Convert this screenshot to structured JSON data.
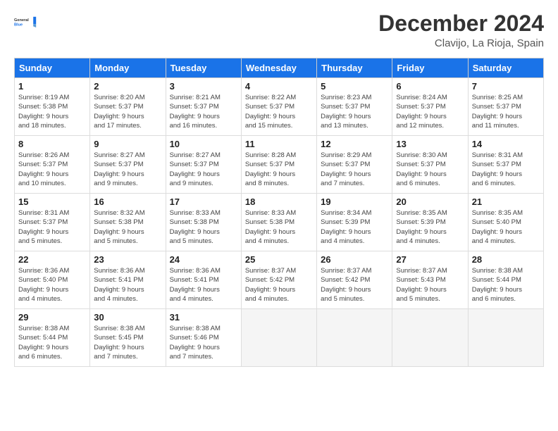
{
  "header": {
    "logo_line1": "General",
    "logo_line2": "Blue",
    "month": "December 2024",
    "location": "Clavijo, La Rioja, Spain"
  },
  "weekdays": [
    "Sunday",
    "Monday",
    "Tuesday",
    "Wednesday",
    "Thursday",
    "Friday",
    "Saturday"
  ],
  "weeks": [
    [
      {
        "day": 1,
        "info": "Sunrise: 8:19 AM\nSunset: 5:38 PM\nDaylight: 9 hours\nand 18 minutes."
      },
      {
        "day": 2,
        "info": "Sunrise: 8:20 AM\nSunset: 5:37 PM\nDaylight: 9 hours\nand 17 minutes."
      },
      {
        "day": 3,
        "info": "Sunrise: 8:21 AM\nSunset: 5:37 PM\nDaylight: 9 hours\nand 16 minutes."
      },
      {
        "day": 4,
        "info": "Sunrise: 8:22 AM\nSunset: 5:37 PM\nDaylight: 9 hours\nand 15 minutes."
      },
      {
        "day": 5,
        "info": "Sunrise: 8:23 AM\nSunset: 5:37 PM\nDaylight: 9 hours\nand 13 minutes."
      },
      {
        "day": 6,
        "info": "Sunrise: 8:24 AM\nSunset: 5:37 PM\nDaylight: 9 hours\nand 12 minutes."
      },
      {
        "day": 7,
        "info": "Sunrise: 8:25 AM\nSunset: 5:37 PM\nDaylight: 9 hours\nand 11 minutes."
      }
    ],
    [
      {
        "day": 8,
        "info": "Sunrise: 8:26 AM\nSunset: 5:37 PM\nDaylight: 9 hours\nand 10 minutes."
      },
      {
        "day": 9,
        "info": "Sunrise: 8:27 AM\nSunset: 5:37 PM\nDaylight: 9 hours\nand 9 minutes."
      },
      {
        "day": 10,
        "info": "Sunrise: 8:27 AM\nSunset: 5:37 PM\nDaylight: 9 hours\nand 9 minutes."
      },
      {
        "day": 11,
        "info": "Sunrise: 8:28 AM\nSunset: 5:37 PM\nDaylight: 9 hours\nand 8 minutes."
      },
      {
        "day": 12,
        "info": "Sunrise: 8:29 AM\nSunset: 5:37 PM\nDaylight: 9 hours\nand 7 minutes."
      },
      {
        "day": 13,
        "info": "Sunrise: 8:30 AM\nSunset: 5:37 PM\nDaylight: 9 hours\nand 6 minutes."
      },
      {
        "day": 14,
        "info": "Sunrise: 8:31 AM\nSunset: 5:37 PM\nDaylight: 9 hours\nand 6 minutes."
      }
    ],
    [
      {
        "day": 15,
        "info": "Sunrise: 8:31 AM\nSunset: 5:37 PM\nDaylight: 9 hours\nand 5 minutes."
      },
      {
        "day": 16,
        "info": "Sunrise: 8:32 AM\nSunset: 5:38 PM\nDaylight: 9 hours\nand 5 minutes."
      },
      {
        "day": 17,
        "info": "Sunrise: 8:33 AM\nSunset: 5:38 PM\nDaylight: 9 hours\nand 5 minutes."
      },
      {
        "day": 18,
        "info": "Sunrise: 8:33 AM\nSunset: 5:38 PM\nDaylight: 9 hours\nand 4 minutes."
      },
      {
        "day": 19,
        "info": "Sunrise: 8:34 AM\nSunset: 5:39 PM\nDaylight: 9 hours\nand 4 minutes."
      },
      {
        "day": 20,
        "info": "Sunrise: 8:35 AM\nSunset: 5:39 PM\nDaylight: 9 hours\nand 4 minutes."
      },
      {
        "day": 21,
        "info": "Sunrise: 8:35 AM\nSunset: 5:40 PM\nDaylight: 9 hours\nand 4 minutes."
      }
    ],
    [
      {
        "day": 22,
        "info": "Sunrise: 8:36 AM\nSunset: 5:40 PM\nDaylight: 9 hours\nand 4 minutes."
      },
      {
        "day": 23,
        "info": "Sunrise: 8:36 AM\nSunset: 5:41 PM\nDaylight: 9 hours\nand 4 minutes."
      },
      {
        "day": 24,
        "info": "Sunrise: 8:36 AM\nSunset: 5:41 PM\nDaylight: 9 hours\nand 4 minutes."
      },
      {
        "day": 25,
        "info": "Sunrise: 8:37 AM\nSunset: 5:42 PM\nDaylight: 9 hours\nand 4 minutes."
      },
      {
        "day": 26,
        "info": "Sunrise: 8:37 AM\nSunset: 5:42 PM\nDaylight: 9 hours\nand 5 minutes."
      },
      {
        "day": 27,
        "info": "Sunrise: 8:37 AM\nSunset: 5:43 PM\nDaylight: 9 hours\nand 5 minutes."
      },
      {
        "day": 28,
        "info": "Sunrise: 8:38 AM\nSunset: 5:44 PM\nDaylight: 9 hours\nand 6 minutes."
      }
    ],
    [
      {
        "day": 29,
        "info": "Sunrise: 8:38 AM\nSunset: 5:44 PM\nDaylight: 9 hours\nand 6 minutes."
      },
      {
        "day": 30,
        "info": "Sunrise: 8:38 AM\nSunset: 5:45 PM\nDaylight: 9 hours\nand 7 minutes."
      },
      {
        "day": 31,
        "info": "Sunrise: 8:38 AM\nSunset: 5:46 PM\nDaylight: 9 hours\nand 7 minutes."
      },
      null,
      null,
      null,
      null
    ]
  ]
}
